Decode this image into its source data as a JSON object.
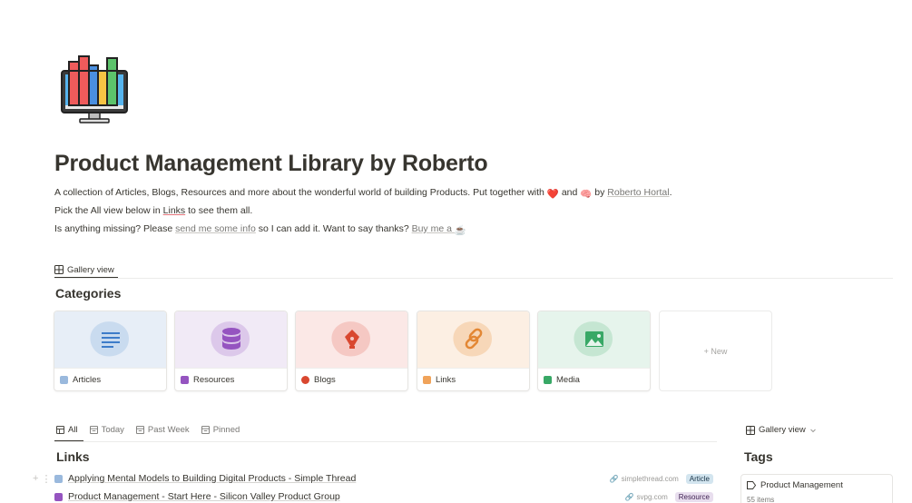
{
  "page": {
    "title": "Product Management Library by Roberto",
    "icon": "computer-books-icon"
  },
  "description": {
    "line1_pre": "A collection of Articles, Blogs, Resources and more about the wonderful world of building Products. Put together with",
    "line1_heart": "❤️",
    "line1_and": "and",
    "line1_brain": "🧠",
    "line1_by": "by",
    "line1_author": "Roberto Hortal",
    "line1_end": ".",
    "line2_pre": "Pick the All view below in",
    "line2_link": "Links",
    "line2_post": "to see them all.",
    "line3_pre": "Is anything missing? Please",
    "line3_link1": "send me some info",
    "line3_mid": "so I can add it. Want to say thanks?",
    "line3_link2": "Buy me a",
    "line3_coffee": "☕"
  },
  "top_view": {
    "label": "Gallery view",
    "icon": "gallery-icon"
  },
  "categories": {
    "title": "Categories",
    "cards": [
      {
        "label": "Articles",
        "icon": "document-lines-icon",
        "bg": "#e7eef7",
        "blob": "#c9dbef",
        "color": "#3d7cc9"
      },
      {
        "label": "Resources",
        "icon": "database-icon",
        "bg": "#f1eaf6",
        "blob": "#dcc8ea",
        "color": "#9554c0"
      },
      {
        "label": "Blogs",
        "icon": "pen-nib-icon",
        "bg": "#fbe8e6",
        "blob": "#f5c8c3",
        "color": "#d9472f"
      },
      {
        "label": "Links",
        "icon": "chain-link-icon",
        "bg": "#fcefe3",
        "blob": "#f7d7b8",
        "color": "#e38734"
      },
      {
        "label": "Media",
        "icon": "image-icon",
        "bg": "#e6f4ec",
        "blob": "#c5e6d2",
        "color": "#38a866"
      }
    ],
    "new_label": "+ New"
  },
  "links_tabs": [
    {
      "label": "All",
      "icon": "table-icon",
      "active": true
    },
    {
      "label": "Today",
      "icon": "calendar-icon",
      "active": false
    },
    {
      "label": "Past Week",
      "icon": "calendar-icon",
      "active": false
    },
    {
      "label": "Pinned",
      "icon": "calendar-icon",
      "active": false
    }
  ],
  "links": {
    "title": "Links",
    "rows": [
      {
        "title": "Applying Mental Models to Building Digital Products - Simple Thread",
        "domain": "simplethread.com",
        "type": "Article",
        "type_bg": "#d3e5ef",
        "type_color": "#183347",
        "icon_color": "#9ab9dd"
      },
      {
        "title": "Product Management - Start Here - Silicon Valley Product Group",
        "domain": "svpg.com",
        "type": "Resource",
        "type_bg": "#e8deee",
        "type_color": "#412454",
        "icon_color": "#9554c0"
      }
    ]
  },
  "right_panel": {
    "view_label": "Gallery view",
    "title": "Tags",
    "tag_name": "Product Management",
    "tag_count": "55 items"
  }
}
